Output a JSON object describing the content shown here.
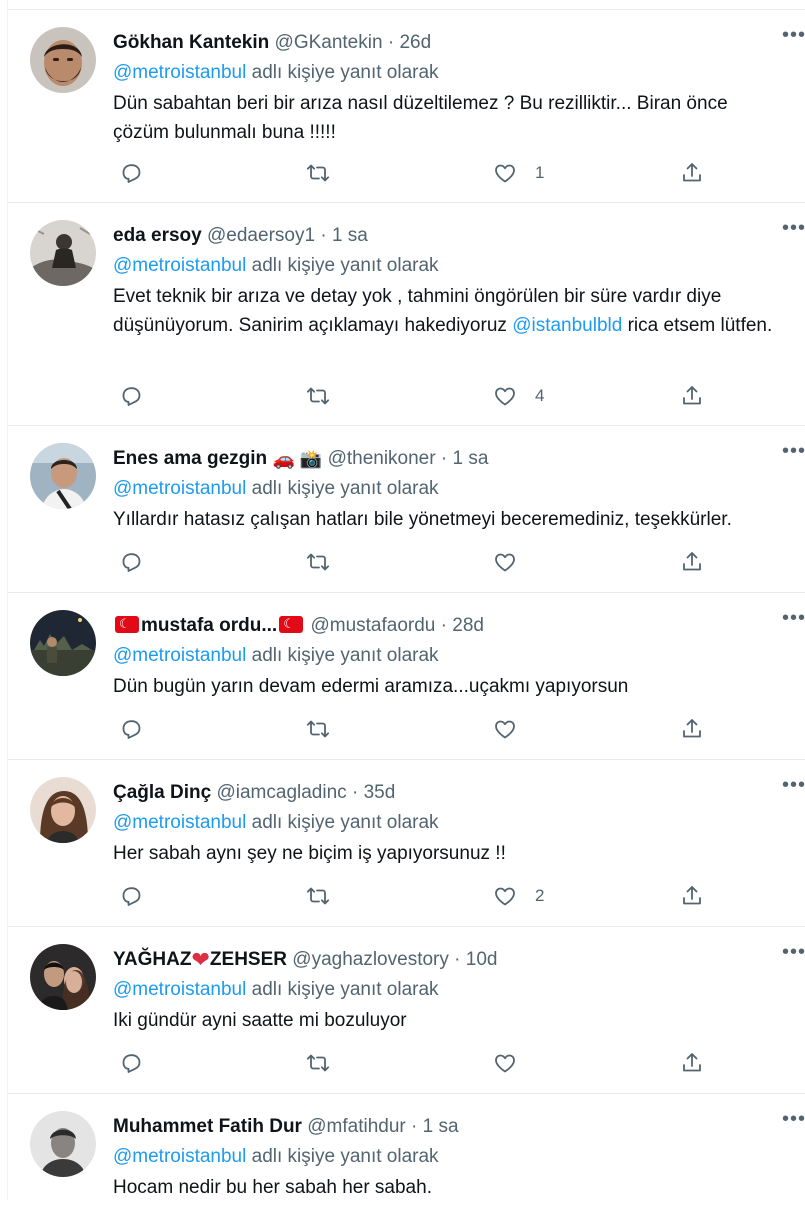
{
  "reply_prefix_label": "adlı kişiye yanıt olarak",
  "more_glyph": "•••",
  "dot": "·",
  "tweets": [
    {
      "name": "Gökhan Kantekin",
      "handle": "@GKantekin",
      "time": "26d",
      "reply_to": "@metroistanbul",
      "text_parts": [
        "Dün sabahtan beri bir arıza nasıl düzeltilemez ? Bu rezilliktir... Biran önce çözüm bulunmalı buna !!!!!"
      ],
      "like_count": "1"
    },
    {
      "name": "eda ersoy",
      "handle": "@edaersoy1",
      "time": "1 sa",
      "reply_to": "@metroistanbul",
      "text_parts": [
        "Evet teknik bir arıza ve detay yok , tahmini öngörülen bir süre vardır diye düşünüyorum. Sanirim açıklamayı hakediyoruz ",
        "@istanbulbld",
        " rica etsem lütfen."
      ],
      "like_count": "4"
    },
    {
      "name": "Enes ama gezgin",
      "name_emoji": "🚗 📸",
      "handle": "@thenikoner",
      "time": "1 sa",
      "reply_to": "@metroistanbul",
      "text_parts": [
        "Yıllardır hatasız çalışan hatları bile yönetmeyi beceremediniz, teşekkürler."
      ],
      "like_count": ""
    },
    {
      "name": "mustafa ordu...",
      "handle": "@mustafaordu",
      "time": "28d",
      "reply_to": "@metroistanbul",
      "text_parts": [
        "Dün bugün yarın devam edermi aramıza...uçakmı yapıyorsun"
      ],
      "like_count": ""
    },
    {
      "name": "Çağla Dinç",
      "handle": "@iamcagladinc",
      "time": "35d",
      "reply_to": "@metroistanbul",
      "text_parts": [
        "Her sabah aynı şey ne biçim iş yapıyorsunuz !!"
      ],
      "like_count": "2"
    },
    {
      "name_part1": "YAĞHAZ",
      "name_part2": "ZEHSER",
      "name_heart": "❤",
      "handle": "@yaghazlovestory",
      "time": "10d",
      "reply_to": "@metroistanbul",
      "text_parts": [
        "Iki gündür ayni saatte mi bozuluyor"
      ],
      "like_count": ""
    },
    {
      "name": "Muhammet Fatih Dur",
      "handle": "@mfatihdur",
      "time": "1 sa",
      "reply_to": "@metroistanbul",
      "text_parts": [
        "Hocam nedir bu her sabah her sabah."
      ],
      "like_count": ""
    }
  ],
  "colors": {
    "link": "#1d9bf0",
    "secondary_text": "#536471",
    "primary_text": "#0f1419",
    "divider": "#e6ecf0",
    "flag_red": "#e30a17"
  },
  "icons": [
    "reply-icon",
    "retweet-icon",
    "like-icon",
    "share-icon",
    "more-icon"
  ]
}
